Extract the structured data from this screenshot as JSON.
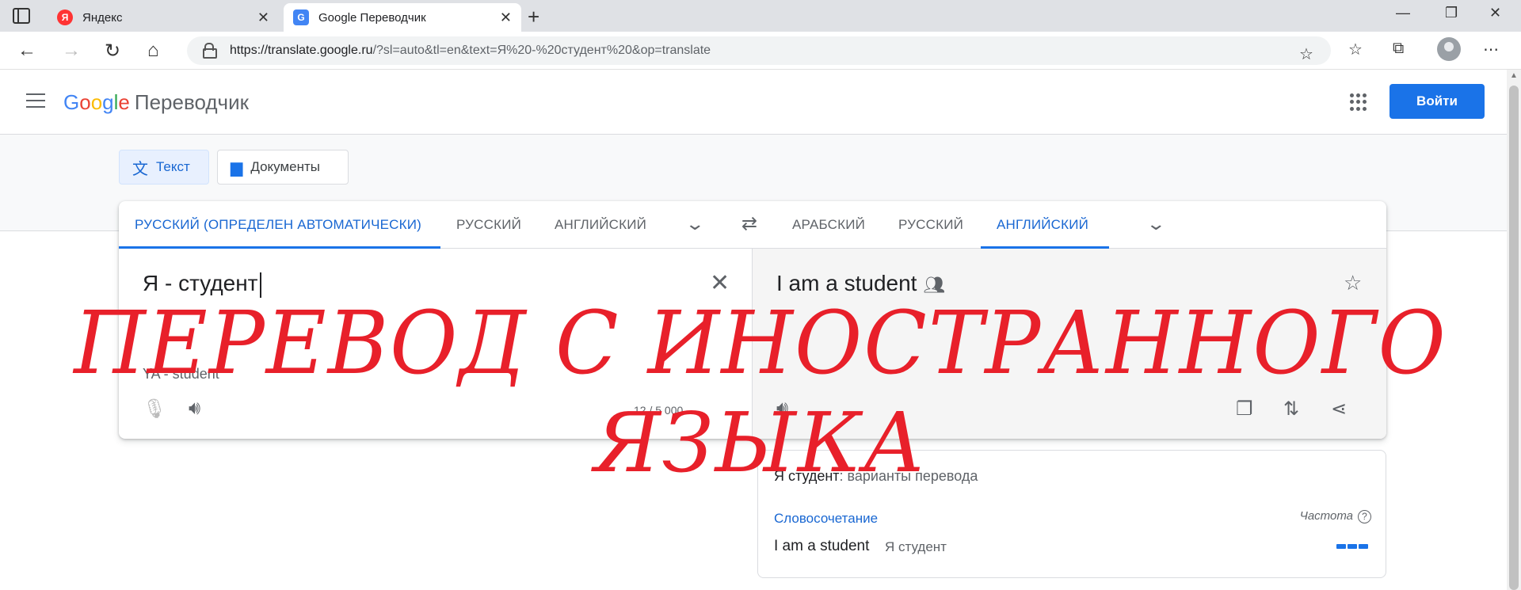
{
  "browser": {
    "tabs": [
      {
        "label": "Яндекс",
        "favicon": "Я"
      },
      {
        "label": "Google Переводчик",
        "favicon": "G"
      }
    ],
    "url_host": "https://translate.google.ru",
    "url_path": "/?sl=auto&tl=en&text=Я%20-%20студент%20&op=translate"
  },
  "header": {
    "logo": [
      "G",
      "o",
      "o",
      "g",
      "l",
      "e"
    ],
    "product": "Переводчик",
    "login_label": "Войти"
  },
  "modes": {
    "text_label": "Текст",
    "docs_label": "Документы"
  },
  "source_langs": [
    "РУССКИЙ (ОПРЕДЕЛЕН АВТОМАТИЧЕСКИ)",
    "РУССКИЙ",
    "АНГЛИЙСКИЙ"
  ],
  "target_langs": [
    "АРАБСКИЙ",
    "РУССКИЙ",
    "АНГЛИЙСКИЙ"
  ],
  "source": {
    "text": "Я - студент",
    "transliteration": "YA - student",
    "counter": "12 / 5 000"
  },
  "target": {
    "text": "I am a student"
  },
  "alternatives": {
    "title_term": "Я студент",
    "title_rest": ": варианты перевода",
    "category": "Словосочетание",
    "frequency_label": "Частота",
    "frequency_help": "?",
    "rows": [
      {
        "en": "I am a student",
        "ru": "Я студент",
        "frequency": 3
      }
    ]
  },
  "overlay": {
    "line1": "ПЕРЕВОД С ИНОСТРАННОГО",
    "line2": "ЯЗЫКА",
    "color": "#e8202a"
  },
  "colors": {
    "accent": "#1a73e8",
    "active_lang": "#1967d2"
  }
}
